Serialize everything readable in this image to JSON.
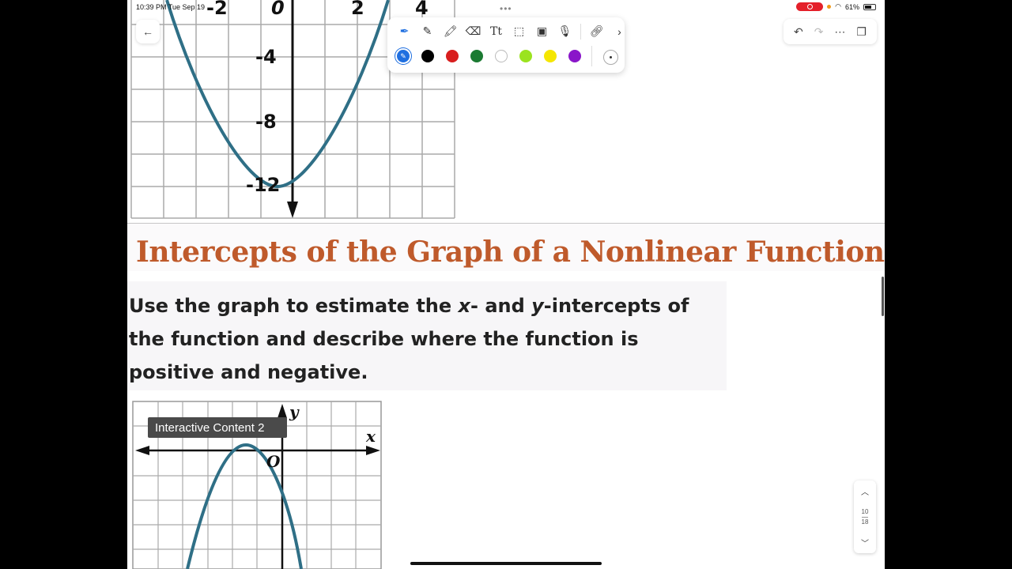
{
  "status": {
    "time_date": "10:39 PM  Tue Sep 19",
    "battery": "61%"
  },
  "heading": "Intercepts of the Graph of a Nonlinear Function",
  "question": {
    "part1": "Use the graph to estimate the ",
    "x": "x",
    "part2": "- and ",
    "y": "y",
    "part3": "-intercepts of the function and describe where the function is positive and negative."
  },
  "graph_top": {
    "labels": [
      "-2",
      "0",
      "2",
      "4",
      "-4",
      "-8",
      "-12"
    ]
  },
  "graph_bottom": {
    "axis_y": "y",
    "axis_x": "x",
    "origin": "O"
  },
  "tooltip": "Interactive Content 2",
  "pager": {
    "current": "10",
    "total": "18"
  },
  "toolbar": {
    "tools": [
      "pen-icon",
      "pencil-icon",
      "highlighter-icon",
      "eraser-icon",
      "text-icon",
      "lasso-icon",
      "image-icon",
      "mic-icon",
      "link-icon",
      "chevron-right-icon"
    ],
    "colors": [
      "#1f6fe0",
      "#000000",
      "#d81e1e",
      "#1b7a32",
      "#ffffff",
      "#9be31f",
      "#f5e600",
      "#8a16c9"
    ]
  }
}
